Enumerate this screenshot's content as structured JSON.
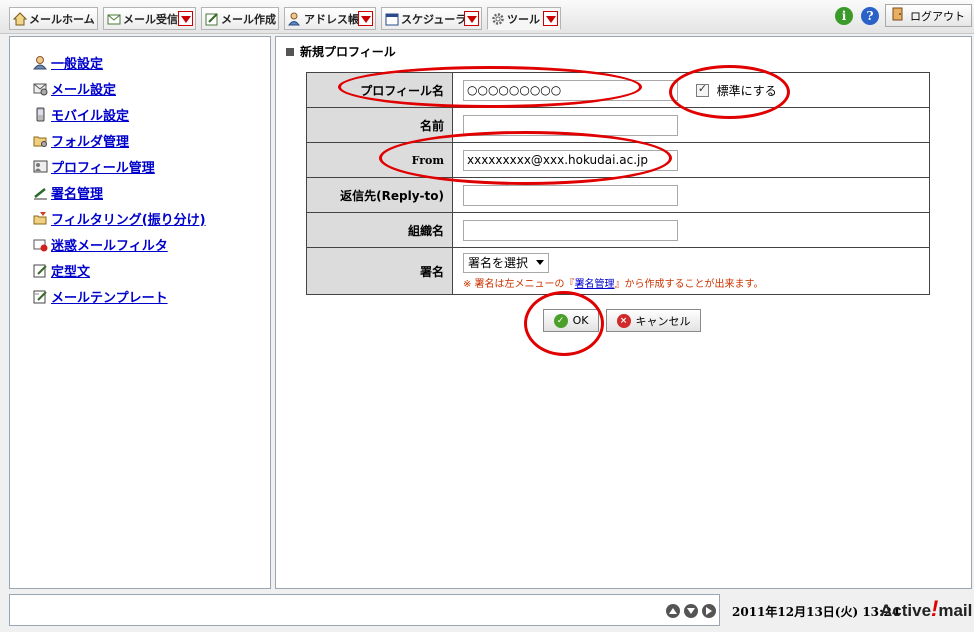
{
  "toolbar": {
    "tabs": [
      {
        "label": "メールホーム",
        "icon": "home-icon"
      },
      {
        "label": "メール受信",
        "icon": "mail-receive-icon"
      },
      {
        "label": "メール作成",
        "icon": "mail-compose-icon"
      },
      {
        "label": "アドレス帳",
        "icon": "address-book-icon"
      },
      {
        "label": "スケジューラ",
        "icon": "calendar-icon"
      },
      {
        "label": "ツール",
        "icon": "gear-icon"
      }
    ],
    "info_glyph": "i",
    "help_glyph": "?",
    "logout_label": "ログアウト"
  },
  "sidebar": {
    "items": [
      {
        "label": "一般設定",
        "icon": "user-settings-icon"
      },
      {
        "label": "メール設定",
        "icon": "mail-settings-icon"
      },
      {
        "label": "モバイル設定",
        "icon": "mobile-icon"
      },
      {
        "label": "フォルダ管理",
        "icon": "folder-icon"
      },
      {
        "label": "プロフィール管理",
        "icon": "profile-icon"
      },
      {
        "label": "署名管理",
        "icon": "signature-icon"
      },
      {
        "label": "フィルタリング(振り分け)",
        "icon": "filter-icon"
      },
      {
        "label": "迷惑メールフィルタ",
        "icon": "spam-filter-icon"
      },
      {
        "label": "定型文",
        "icon": "template-text-icon"
      },
      {
        "label": "メールテンプレート",
        "icon": "mail-template-icon"
      }
    ]
  },
  "main": {
    "title": "新規プロフィール",
    "form": {
      "profile_name_label": "プロフィール名",
      "profile_name_value": "○○○○○○○○○",
      "default_checkbox_label": "標準にする",
      "default_checked": true,
      "name_label": "名前",
      "name_value": "",
      "from_label": "From",
      "from_value": "xxxxxxxxx@xxx.hokudai.ac.jp",
      "reply_to_label": "返信先(Reply-to)",
      "reply_to_value": "",
      "org_label": "組織名",
      "org_value": "",
      "signature_label": "署名",
      "signature_select": "署名を選択",
      "note_prefix": "※ 署名は左メニューの『",
      "note_link": "署名管理",
      "note_suffix": "』から作成することが出来ます。"
    },
    "ok_label": "OK",
    "cancel_label": "キャンセル"
  },
  "footer": {
    "datetime": "2011年12月13日(火) 13:24",
    "brand_prefix": "Active",
    "brand_bang": "!",
    "brand_suffix": "mail"
  },
  "colors": {
    "annotation_red": "#e00000",
    "link_blue": "#0000cc",
    "label_bg": "#dcdcdc"
  }
}
